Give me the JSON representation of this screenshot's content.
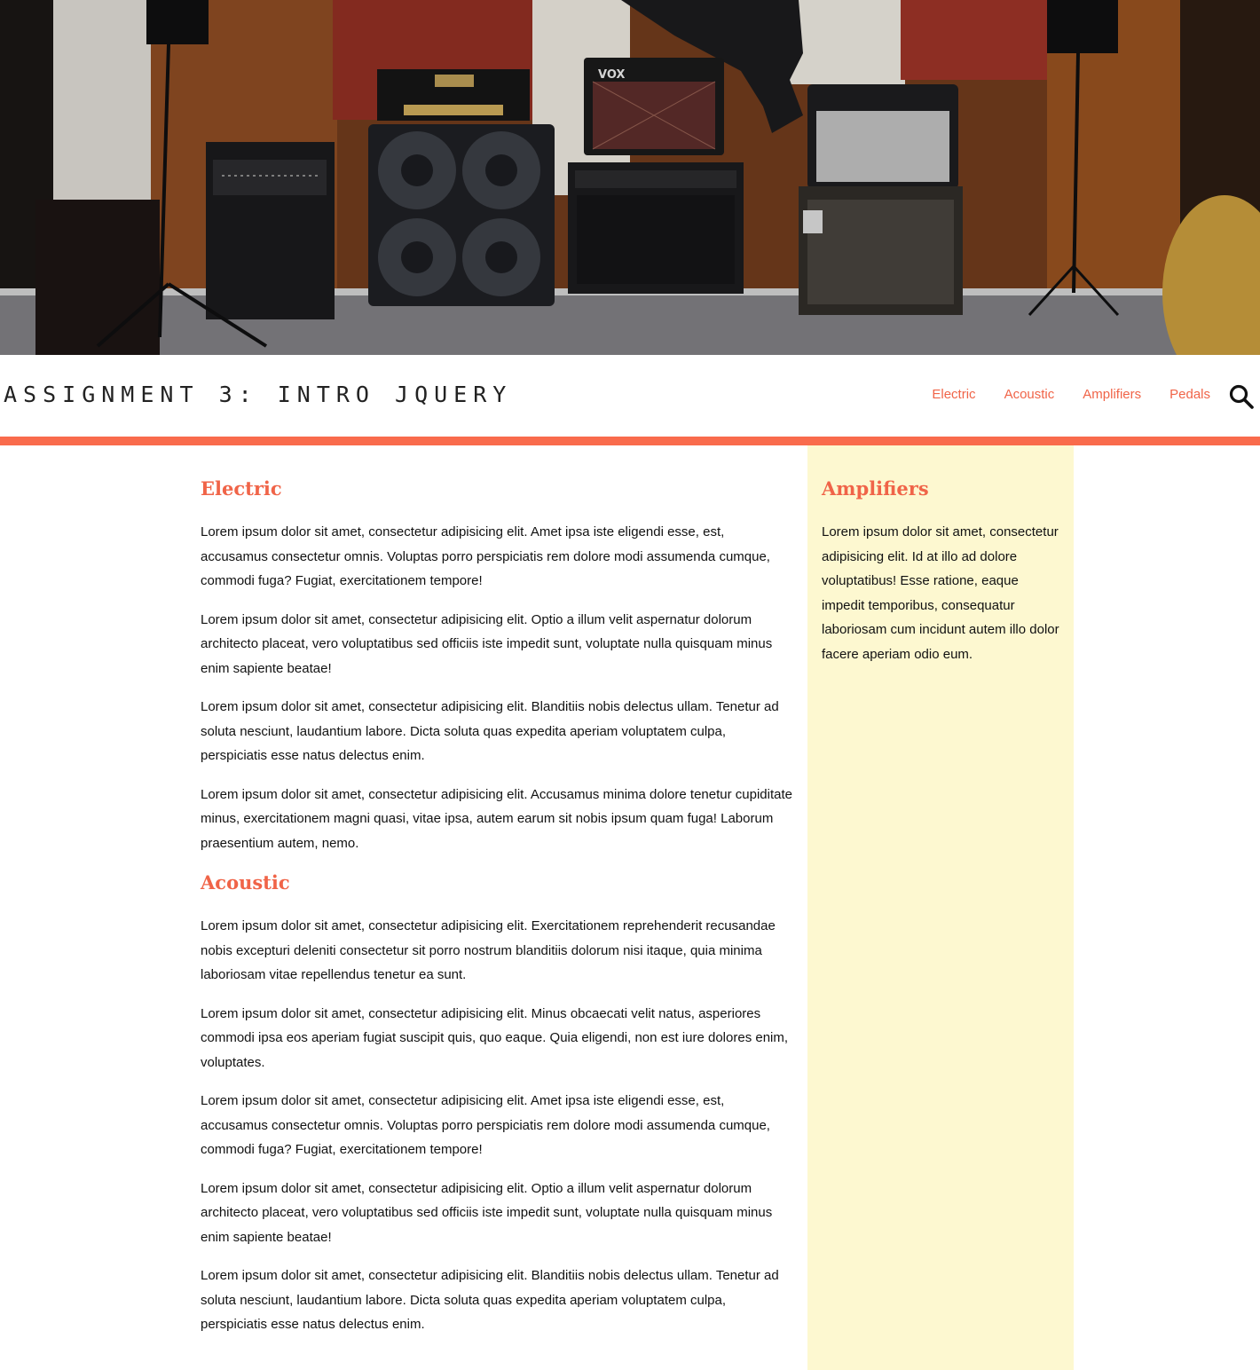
{
  "site": {
    "title": "ASSIGNMENT 3: INTRO JQUERY",
    "accent_color": "#f06448",
    "rule_color": "#f96b4c",
    "sidebar_bg": "#fdf8d0"
  },
  "hero": {
    "alt": "Guitar amplifiers and speaker cabinets in a rehearsal studio",
    "amp_brand_label": "VOX"
  },
  "nav": {
    "items": [
      "Electric",
      "Acoustic",
      "Amplifiers",
      "Pedals"
    ],
    "search_icon": "search-icon"
  },
  "main": {
    "sections": [
      {
        "heading": "Electric",
        "paragraphs": [
          "Lorem ipsum dolor sit amet, consectetur adipisicing elit. Amet ipsa iste eligendi esse, est, accusamus consectetur omnis. Voluptas porro perspiciatis rem dolore modi assumenda cumque, commodi fuga? Fugiat, exercitationem tempore!",
          "Lorem ipsum dolor sit amet, consectetur adipisicing elit. Optio a illum velit aspernatur dolorum architecto placeat, vero voluptatibus sed officiis iste impedit sunt, voluptate nulla quisquam minus enim sapiente beatae!",
          "Lorem ipsum dolor sit amet, consectetur adipisicing elit. Blanditiis nobis delectus ullam. Tenetur ad soluta nesciunt, laudantium labore. Dicta soluta quas expedita aperiam voluptatem culpa, perspiciatis esse natus delectus enim.",
          "Lorem ipsum dolor sit amet, consectetur adipisicing elit. Accusamus minima dolore tenetur cupiditate minus, exercitationem magni quasi, vitae ipsa, autem earum sit nobis ipsum quam fuga! Laborum praesentium autem, nemo."
        ]
      },
      {
        "heading": "Acoustic",
        "paragraphs": [
          "Lorem ipsum dolor sit amet, consectetur adipisicing elit. Exercitationem reprehenderit recusandae nobis excepturi deleniti consectetur sit porro nostrum blanditiis dolorum nisi itaque, quia minima laboriosam vitae repellendus tenetur ea sunt.",
          "Lorem ipsum dolor sit amet, consectetur adipisicing elit. Minus obcaecati velit natus, asperiores commodi ipsa eos aperiam fugiat suscipit quis, quo eaque. Quia eligendi, non est iure dolores enim, voluptates.",
          "Lorem ipsum dolor sit amet, consectetur adipisicing elit. Amet ipsa iste eligendi esse, est, accusamus consectetur omnis. Voluptas porro perspiciatis rem dolore modi assumenda cumque, commodi fuga? Fugiat, exercitationem tempore!",
          "Lorem ipsum dolor sit amet, consectetur adipisicing elit. Optio a illum velit aspernatur dolorum architecto placeat, vero voluptatibus sed officiis iste impedit sunt, voluptate nulla quisquam minus enim sapiente beatae!",
          "Lorem ipsum dolor sit amet, consectetur adipisicing elit. Blanditiis nobis delectus ullam. Tenetur ad soluta nesciunt, laudantium labore. Dicta soluta quas expedita aperiam voluptatem culpa, perspiciatis esse natus delectus enim."
        ]
      }
    ]
  },
  "sidebar": {
    "heading": "Amplifiers",
    "paragraph": "Lorem ipsum dolor sit amet, consectetur adipisicing elit. Id at illo ad dolore voluptatibus! Esse ratione, eaque impedit temporibus, consequatur laboriosam cum incidunt autem illo dolor facere aperiam odio eum."
  }
}
